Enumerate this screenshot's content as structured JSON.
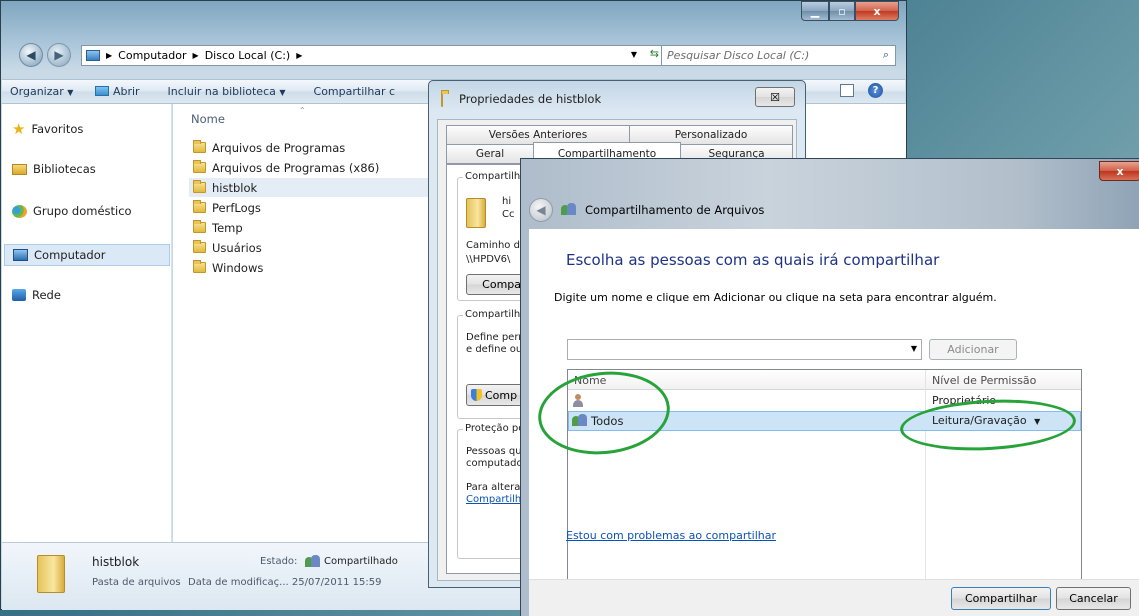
{
  "explorer": {
    "breadcrumb": [
      "Computador",
      "Disco Local (C:)"
    ],
    "search_placeholder": "Pesquisar Disco Local (C:)",
    "toolbar": {
      "organize": "Organizar",
      "open": "Abrir",
      "include_library": "Incluir na biblioteca",
      "share": "Compartilhar c"
    },
    "nav": {
      "favorites": "Favoritos",
      "libraries": "Bibliotecas",
      "homegroup": "Grupo doméstico",
      "computer": "Computador",
      "network": "Rede"
    },
    "column_name": "Nome",
    "files": [
      "Arquivos de Programas",
      "Arquivos de Programas (x86)",
      "histblok",
      "PerfLogs",
      "Temp",
      "Usuários",
      "Windows"
    ],
    "details": {
      "name": "histblok",
      "type": "Pasta de arquivos",
      "state_label": "Estado:",
      "state_value": "Compartilhado",
      "modified": "Data de modificaç... 25/07/2011 15:59"
    }
  },
  "properties": {
    "title": "Propriedades de histblok",
    "close": "☒",
    "tabs_row1": [
      "Versões Anteriores",
      "Personalizado"
    ],
    "tabs_row2": [
      "Geral",
      "Compartilhamento",
      "Segurança"
    ],
    "group1_label": "Compartilha",
    "folder_line1": "hi",
    "folder_line2": "Cc",
    "path_label": "Caminho de",
    "path_value": "\\\\HPDV6\\",
    "share_btn": "Compart",
    "group2_label": "Compartilhar",
    "group2_text1": "Define pern",
    "group2_text2": "e define out",
    "advanced_btn": "Comp",
    "group3_label": "Proteção po",
    "group3_text1": "Pessoas qu",
    "group3_text2": "computador",
    "group3_text3": "Para alterar",
    "group3_link": "Compartilha"
  },
  "wizard": {
    "close": "x",
    "title": "Compartilhamento de Arquivos",
    "heading": "Escolha as pessoas com as quais irá compartilhar",
    "instruction": "Digite um nome e clique em Adicionar ou clique na seta para encontrar alguém.",
    "combo_value": "",
    "add_btn": "Adicionar",
    "col_name": "Nome",
    "col_permission": "Nível de Permissão",
    "rows": [
      {
        "name": "",
        "permission": "Proprietário"
      },
      {
        "name": "Todos",
        "permission": "Leitura/Gravação"
      }
    ],
    "help_link": "Estou com problemas ao compartilhar",
    "share_btn": "Compartilhar",
    "cancel_btn": "Cancelar"
  },
  "colors": {
    "heading": "#1e3287",
    "link": "#0b52b8",
    "annotation": "#27a33a",
    "selection": "#cde4f7"
  }
}
